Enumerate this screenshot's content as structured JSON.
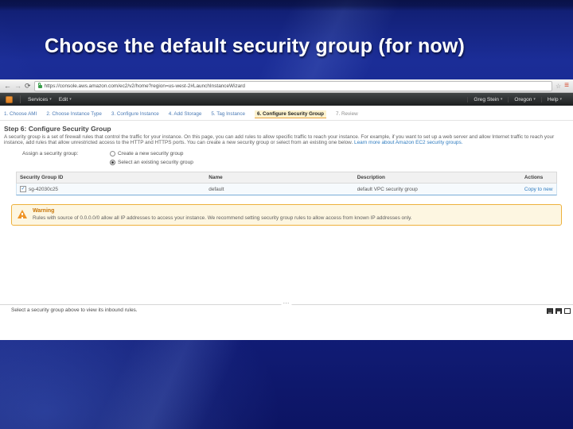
{
  "slide": {
    "title": "Choose the default security group (for now)"
  },
  "browser": {
    "url": "https://console.aws.amazon.com/ec2/v2/home?region=us-west-2#LaunchInstanceWizard",
    "back_icon": "←",
    "forward_icon": "→",
    "refresh_icon": "⟳",
    "bookmark_icon": "☆",
    "menu_icon": "≡"
  },
  "nav": {
    "services": "Services",
    "edit": "Edit",
    "account": "Greg Stein",
    "region": "Oregon",
    "help": "Help",
    "caret": "▾"
  },
  "wizard": {
    "steps": [
      "1. Choose AMI",
      "2. Choose Instance Type",
      "3. Configure Instance",
      "4. Add Storage",
      "5. Tag Instance",
      "6. Configure Security Group",
      "7. Review"
    ]
  },
  "step6": {
    "heading": "Step 6: Configure Security Group",
    "description": "A security group is a set of firewall rules that control the traffic for your instance. On this page, you can add rules to allow specific traffic to reach your instance. For example, if you want to set up a web server and allow Internet traffic to reach your instance, add rules that allow unrestricted access to the HTTP and HTTPS ports. You can create a new security group or select from an existing one below.",
    "learn_more": "Learn more about Amazon EC2 security groups.",
    "assign_label": "Assign a security group:",
    "radio_create": "Create a new security group",
    "radio_select": "Select an existing security group"
  },
  "sg_table": {
    "headers": [
      "Security Group ID",
      "Name",
      "Description",
      "Actions"
    ],
    "row": {
      "check": "✓",
      "id": "sg-42030c25",
      "name": "default",
      "description": "default VPC security group",
      "action": "Copy to new"
    }
  },
  "warning": {
    "title": "Warning",
    "text": "Rules with source of 0.0.0.0/0 allow all IP addresses to access your instance. We recommend setting security group rules to allow access from known IP addresses only."
  },
  "footer": {
    "hint": "Select a security group above to view its inbound rules.",
    "handle": "⋯"
  },
  "colors": {
    "aws_orange": "#e8862c",
    "link_blue": "#2e7bbf",
    "warning_orange": "#c77405",
    "slide_blue": "#17268c"
  }
}
